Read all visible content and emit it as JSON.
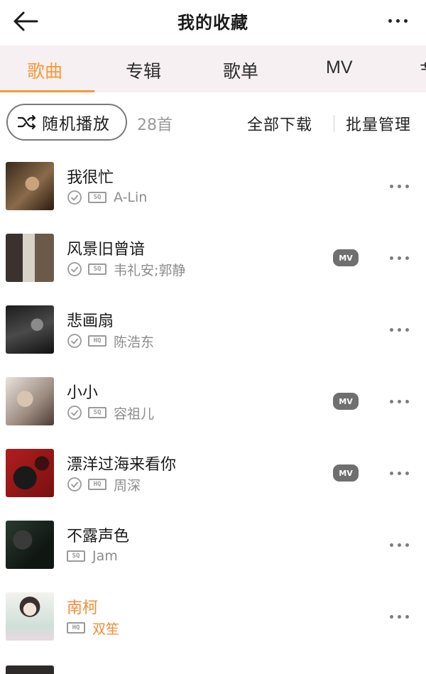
{
  "header": {
    "title": "我的收藏",
    "back_icon": "arrow-left-icon",
    "more_icon": "more-horizontal-icon"
  },
  "tabs": [
    {
      "label": "歌曲",
      "active": true
    },
    {
      "label": "专辑",
      "active": false
    },
    {
      "label": "歌单",
      "active": false
    },
    {
      "label": "MV",
      "active": false
    },
    {
      "label": "节",
      "active": false
    }
  ],
  "actions": {
    "shuffle_label": "随机播放",
    "count": "28首",
    "download_all": "全部下载",
    "batch_manage": "批量管理"
  },
  "colors": {
    "accent": "#f39a3a",
    "tab_bg": "#f6f0f2",
    "mv_badge": "#6f6f6f"
  },
  "songs": [
    {
      "name": "我很忙",
      "downloaded": true,
      "quality": "SQ",
      "artist": "A-Lin",
      "mv": false,
      "playing": false
    },
    {
      "name": "风景旧曾谙",
      "downloaded": true,
      "quality": "SQ",
      "artist": "韦礼安;郭静",
      "mv": true,
      "mv_label": "MV",
      "playing": false
    },
    {
      "name": "悲画扇",
      "downloaded": true,
      "quality": "HQ",
      "artist": "陈浩东",
      "mv": false,
      "playing": false
    },
    {
      "name": "小小",
      "downloaded": true,
      "quality": "SQ",
      "artist": "容祖儿",
      "mv": true,
      "mv_label": "MV",
      "playing": false
    },
    {
      "name": "漂洋过海来看你",
      "downloaded": true,
      "quality": "HQ",
      "artist": "周深",
      "mv": true,
      "mv_label": "MV",
      "playing": false
    },
    {
      "name": "不露声色",
      "downloaded": false,
      "quality": "SQ",
      "artist": "Jam",
      "mv": false,
      "playing": false
    },
    {
      "name": "南柯",
      "downloaded": false,
      "quality": "HQ",
      "artist": "双笙",
      "mv": false,
      "playing": true
    }
  ]
}
